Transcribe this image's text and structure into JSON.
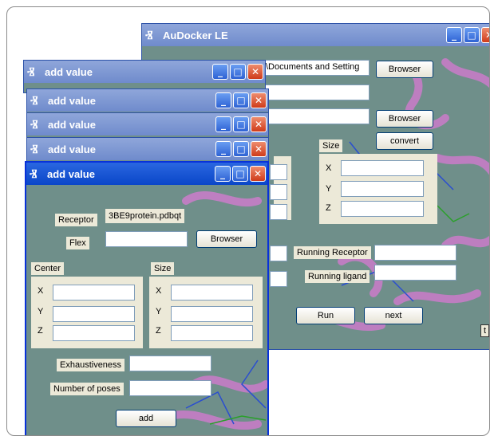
{
  "main_window": {
    "title": "AuDocker LE",
    "path_value": "\\Documents and Setting",
    "browser_label": "Browser",
    "browser2_label": "Browser",
    "convert_label": "convert",
    "size_label": "Size",
    "x_label": "X",
    "y_label": "Y",
    "z_label": "Z",
    "running_receptor_label": "Running Receptor",
    "running_ligand_label": "Running ligand",
    "run_label": "Run",
    "next_label": "next",
    "corner_label": "t"
  },
  "stacked_windows": [
    {
      "title": "add value"
    },
    {
      "title": "add value"
    },
    {
      "title": "add value"
    },
    {
      "title": "add value"
    }
  ],
  "dialog": {
    "title": "add value",
    "receptor_label": "Receptor",
    "receptor_value": "3BE9protein.pdbqt",
    "flex_label": "Flex",
    "browser_label": "Browser",
    "center_label": "Center",
    "size_label": "Size",
    "x_label": "X",
    "y_label": "Y",
    "z_label": "Z",
    "exhaustiveness_label": "Exhaustiveness",
    "poses_label": "Number of poses",
    "add_label": "add"
  },
  "window_buttons": {
    "minimize": "_",
    "maximize": "□",
    "close": "✕"
  },
  "colors": {
    "title_active": "#0a46c8",
    "title_inactive": "#7b93d3",
    "panel": "#ece9d8",
    "window_bg": "#6f8f8a",
    "molecule": "#c77bc7"
  }
}
